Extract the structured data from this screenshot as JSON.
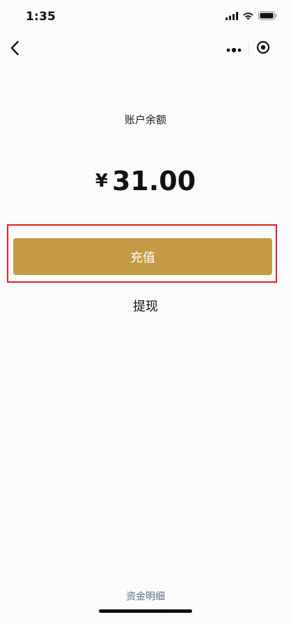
{
  "status_bar": {
    "time": "1:35",
    "icons": [
      "signal-icon",
      "wifi-icon",
      "battery-icon"
    ]
  },
  "nav": {
    "back_icon": "chevron-left-icon",
    "more_icon": "more-dots-icon",
    "close_icon": "target-circle-icon"
  },
  "balance": {
    "label": "账户余额",
    "currency": "¥",
    "amount": "31.00"
  },
  "actions": {
    "recharge_label": "充值",
    "withdraw_label": "提现"
  },
  "footer": {
    "fund_details_label": "资金明细"
  },
  "colors": {
    "accent": "#c49a46",
    "highlight": "#e02020",
    "link": "#5a6f8f"
  }
}
